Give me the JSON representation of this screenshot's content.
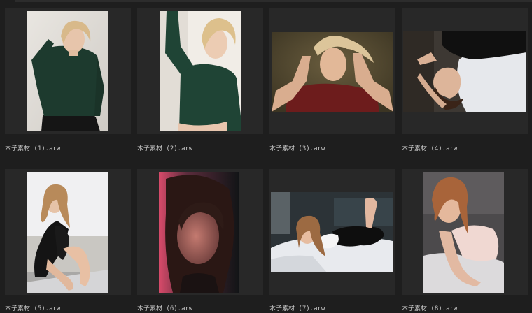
{
  "browser": {
    "items": [
      {
        "filename": "木子素材 (1).arw",
        "thumbnail": "portrait-photo-1"
      },
      {
        "filename": "木子素材 (2).arw",
        "thumbnail": "portrait-photo-2"
      },
      {
        "filename": "木子素材 (3).arw",
        "thumbnail": "portrait-photo-3"
      },
      {
        "filename": "木子素材 (4).arw",
        "thumbnail": "portrait-photo-4"
      },
      {
        "filename": "木子素材 (5).arw",
        "thumbnail": "portrait-photo-5"
      },
      {
        "filename": "木子素材 (6).arw",
        "thumbnail": "portrait-photo-6"
      },
      {
        "filename": "木子素材 (7).arw",
        "thumbnail": "portrait-photo-7"
      },
      {
        "filename": "木子素材 (8).arw",
        "thumbnail": "portrait-photo-8"
      }
    ]
  },
  "colors": {
    "background": "#1e1e1e",
    "cell": "#282828",
    "caption": "#c8c8c8"
  }
}
